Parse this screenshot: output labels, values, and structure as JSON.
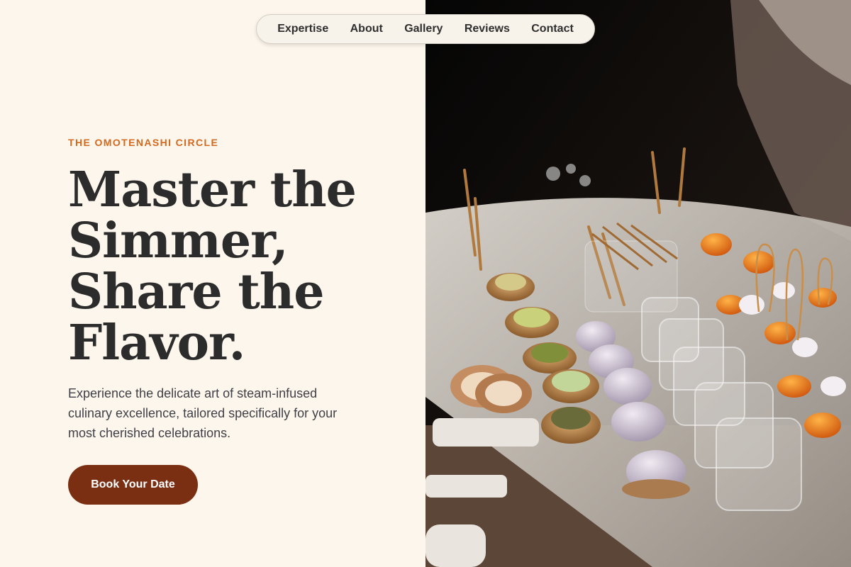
{
  "nav": {
    "items": [
      "Expertise",
      "About",
      "Gallery",
      "Reviews",
      "Contact"
    ]
  },
  "hero": {
    "eyebrow": "THE OMOTENASHI CIRCLE",
    "headline_lines": [
      "Master the",
      "Simmer,",
      "Share the",
      "Flavor."
    ],
    "subtext": "Experience the delicate art of steam-infused culinary excellence, tailored specifically for your most cherished celebrations.",
    "cta_label": "Book Your Date"
  },
  "colors": {
    "background": "#fdf6ec",
    "accent": "#d2691e",
    "cta": "#7a2e12",
    "headline": "#2c2c2c"
  }
}
